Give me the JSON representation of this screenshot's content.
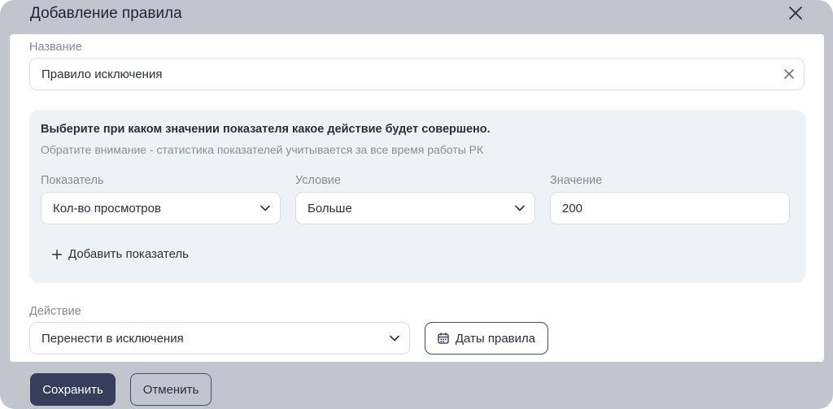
{
  "dialog": {
    "title": "Добавление правила",
    "close_icon": "close-icon"
  },
  "name_field": {
    "label": "Название",
    "value": "Правило исключения",
    "clear_icon": "clear-icon"
  },
  "rule_panel": {
    "heading": "Выберите при каком значении показателя какое действие будет совершено.",
    "note": "Обратите внимание - статистика показателей учитывается за все время работы РК",
    "indicator": {
      "label": "Показатель",
      "value": "Кол-во просмотров"
    },
    "condition": {
      "label": "Условие",
      "value": "Больше"
    },
    "threshold": {
      "label": "Значение",
      "value": "200"
    },
    "add_indicator_label": "Добавить показатель"
  },
  "action_field": {
    "label": "Действие",
    "value": "Перенести в исключения"
  },
  "dates_button_label": "Даты правила",
  "footer": {
    "save_label": "Сохранить",
    "cancel_label": "Отменить"
  },
  "colors": {
    "overlay": "#c3c5ce",
    "panel_bg": "#eef2f6",
    "primary": "#363e5c"
  }
}
